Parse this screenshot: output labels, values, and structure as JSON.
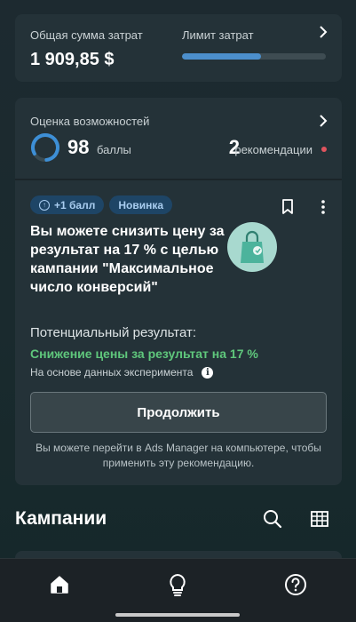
{
  "spend": {
    "total_label": "Общая сумма затрат",
    "total_value": "1 909,85 $",
    "limit_label": "Лимит затрат",
    "limit_progress": 0.55
  },
  "opportunity": {
    "label": "Оценка возможностей",
    "score": "98",
    "score_unit": "баллы",
    "score_fraction": 0.98,
    "recommendations_count": "2",
    "recommendations_label": "рекомендации"
  },
  "recommendation": {
    "badge_points": "+1 балл",
    "badge_new": "Новинка",
    "title": "Вы можете снизить цену за результат на 17 % с целью кампании \"Максимальное число конверсий\"",
    "potential_label": "Потенциальный результат:",
    "potential_value": "Снижение цены за результат на 17 %",
    "based_on": "На основе данных эксперимента",
    "continue_label": "Продолжить",
    "footnote": "Вы можете перейти в Ads Manager на компьютере, чтобы применить эту рекомендацию."
  },
  "campaigns": {
    "title": "Кампании"
  },
  "nav": {
    "items": [
      "home-icon",
      "lightbulb-icon",
      "help-icon"
    ]
  },
  "colors": {
    "accent_blue": "#4c8fcc",
    "success_green": "#5fc77c",
    "badge_bg": "#1e4566",
    "alert_red": "#e0545e"
  }
}
